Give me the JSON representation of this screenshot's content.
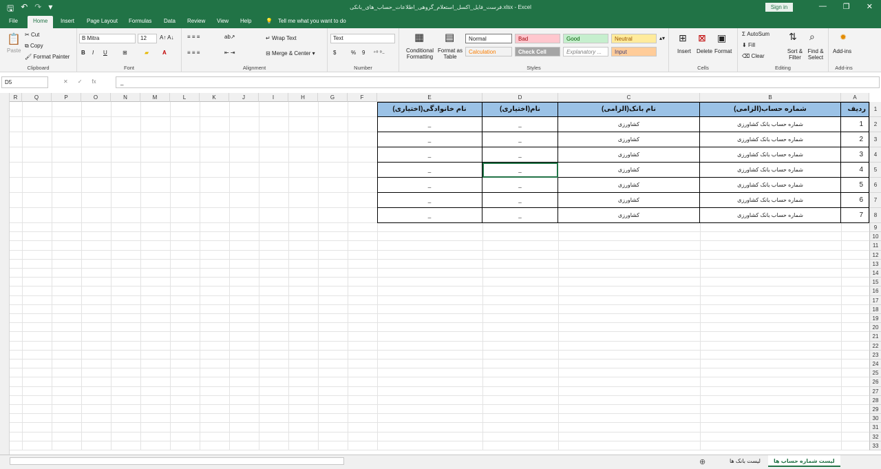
{
  "window": {
    "title": "فرست_فایل_اکسل_استعلام_گروهی_اطلاعات_حساب_های_بانکی.xlsx - Excel",
    "signin": "Sign in"
  },
  "qat": {
    "save_icon": "save-icon",
    "undo_icon": "undo-icon",
    "redo_icon": "redo-icon",
    "customize_icon": "customize-icon"
  },
  "tabs": [
    "File",
    "Home",
    "Insert",
    "Page Layout",
    "Formulas",
    "Data",
    "Review",
    "View",
    "Help"
  ],
  "tell_me": "Tell me what you want to do",
  "clipboard": {
    "paste": "Paste",
    "cut": "Cut",
    "copy": "Copy",
    "painter": "Format Painter",
    "label": "Clipboard"
  },
  "font": {
    "name": "B Mitra",
    "size": "12",
    "label": "Font",
    "bold": "B",
    "italic": "I",
    "underline": "U"
  },
  "alignment": {
    "wrap": "Wrap Text",
    "merge": "Merge & Center",
    "label": "Alignment"
  },
  "number": {
    "format": "Text",
    "label": "Number",
    "currency": "$",
    "percent": "%",
    "comma": "9"
  },
  "styles": {
    "conditional": "Conditional Formatting",
    "format_table": "Format as Table",
    "normal": "Normal",
    "bad": "Bad",
    "good": "Good",
    "neutral": "Neutral",
    "calculation": "Calculation",
    "check_cell": "Check Cell",
    "explanatory": "Explanatory ...",
    "input": "Input",
    "label": "Styles"
  },
  "cells": {
    "insert": "Insert",
    "delete": "Delete",
    "format": "Format",
    "label": "Cells"
  },
  "editing": {
    "autosum": "AutoSum",
    "fill": "Fill",
    "clear": "Clear",
    "sort": "Sort & Filter",
    "find": "Find & Select",
    "label": "Editing"
  },
  "addins": {
    "name": "Add-ins",
    "label": "Add-ins"
  },
  "formula_bar": {
    "namebox": "D5",
    "fx": "fx",
    "value": "_"
  },
  "columns": [
    "A",
    "B",
    "C",
    "D",
    "E",
    "F",
    "G",
    "H",
    "I",
    "J",
    "K",
    "L",
    "M",
    "N",
    "O",
    "P",
    "Q",
    "R"
  ],
  "table": {
    "headers": [
      "ردیف",
      "شماره حساب(الزامی)",
      "نام بانک(الزامی)",
      "نام(اختیاری)",
      "نام خانوادگی(اختیاری)"
    ],
    "rows": [
      [
        "1",
        "شماره حساب بانک کشاورزی",
        "کشاورزی",
        "_",
        "_"
      ],
      [
        "2",
        "شماره حساب بانک کشاورزی",
        "کشاورزی",
        "_",
        "_"
      ],
      [
        "3",
        "شماره حساب بانک کشاورزی",
        "کشاورزی",
        "_",
        "_"
      ],
      [
        "4",
        "شماره حساب بانک کشاورزی",
        "کشاورزی",
        "_",
        "_"
      ],
      [
        "5",
        "شماره حساب بانک کشاورزی",
        "کشاورزی",
        "_",
        "_"
      ],
      [
        "6",
        "شماره حساب بانک کشاورزی",
        "کشاورزی",
        "_",
        "_"
      ],
      [
        "7",
        "شماره حساب بانک کشاورزی",
        "کشاورزی",
        "_",
        "_"
      ]
    ]
  },
  "row_numbers": [
    "1",
    "2",
    "3",
    "4",
    "5",
    "6",
    "7",
    "8",
    "9",
    "10",
    "11",
    "12",
    "13",
    "14",
    "15",
    "16",
    "17",
    "18",
    "19",
    "20",
    "21",
    "22",
    "23",
    "24",
    "25",
    "26",
    "27",
    "28",
    "29",
    "30",
    "31",
    "32",
    "33"
  ],
  "sheets": [
    "لیست شماره حساب ها",
    "لیست بانک ها"
  ],
  "colors": {
    "excel_green": "#217346",
    "header_fill": "#9bc2e6"
  }
}
